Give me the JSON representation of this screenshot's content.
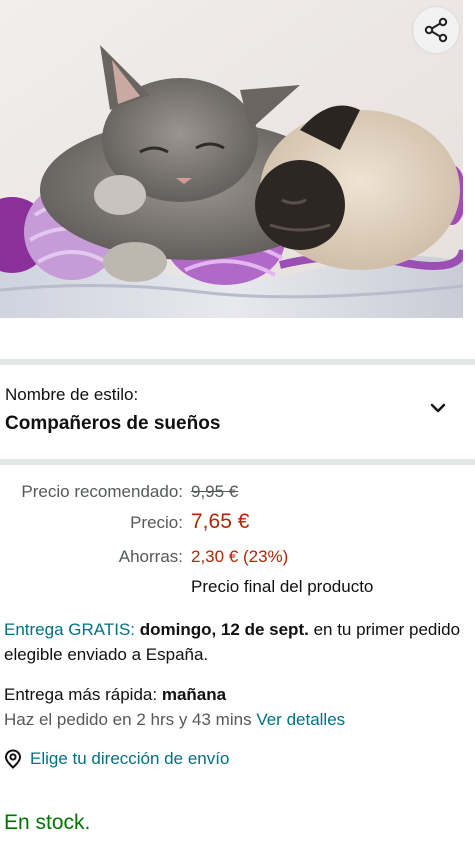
{
  "image": {
    "alt_icon": "kitten-and-pug-sleeping-image"
  },
  "share": {
    "icon": "share-icon"
  },
  "style_selector": {
    "label": "Nombre de estilo:",
    "value": "Compañeros de sueños",
    "icon": "chevron-down-icon"
  },
  "pricing": {
    "recommended_label": "Precio recomendado:",
    "recommended_value": "9,95 €",
    "price_label": "Precio:",
    "price_value": "7,65 €",
    "savings_label": "Ahorras:",
    "savings_value": "2,30 € (23%)",
    "final_note": "Precio final del producto"
  },
  "delivery": {
    "free_label": "Entrega GRATIS:",
    "date": "domingo, 12 de sept.",
    "rest": "en tu primer pedido elegible enviado a España."
  },
  "fast_delivery": {
    "label": "Entrega más rápida:",
    "when": "mañana",
    "order_within": "Haz el pedido en 2 hrs y 43 mins",
    "details_link": "Ver detalles"
  },
  "address": {
    "icon": "location-pin-icon",
    "label": "Elige tu dirección de envío"
  },
  "stock": {
    "text": "En stock."
  },
  "colors": {
    "price": "#b12704",
    "link": "#007185",
    "in_stock": "#007600",
    "divider": "#e3e6e6"
  }
}
